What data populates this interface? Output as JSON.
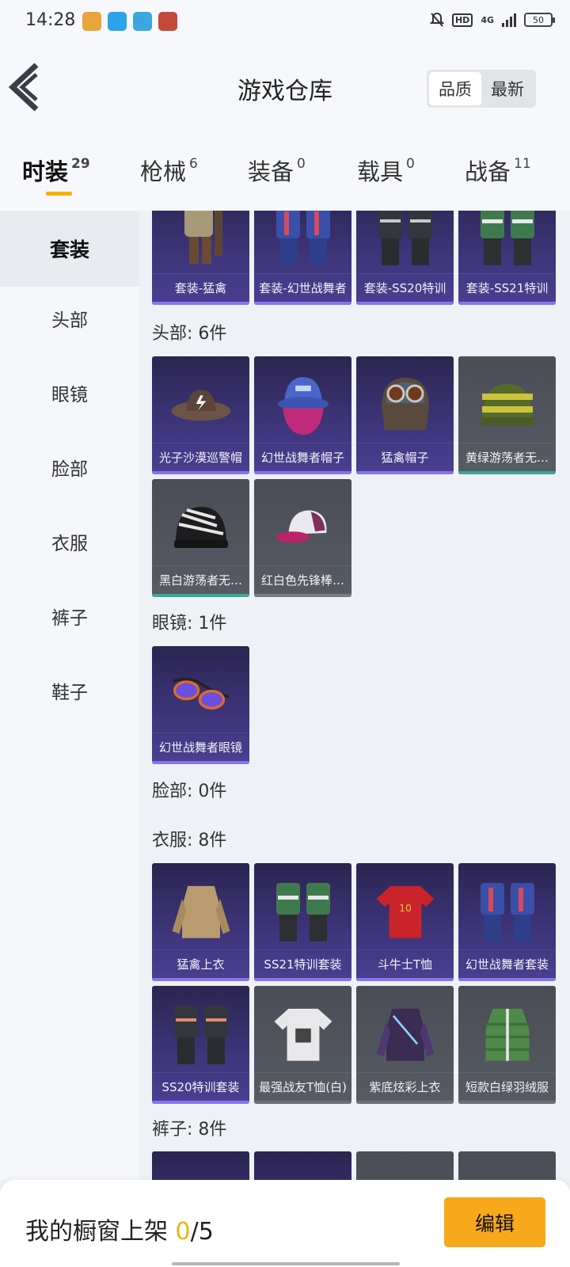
{
  "status_bar": {
    "time": "14:28",
    "apps": [
      {
        "icon": "game-app-icon",
        "color": "#e8a53a"
      },
      {
        "icon": "qq-penguin-icon",
        "color": "#2aa4e6"
      },
      {
        "icon": "app-100-icon",
        "color": "#3aa7e0"
      },
      {
        "icon": "demon-app-icon",
        "color": "#c24a3a"
      }
    ],
    "hd_label": "HD",
    "network_label": "4G",
    "battery": "50"
  },
  "header": {
    "title": "游戏仓库",
    "sort_options": [
      "品质",
      "最新"
    ],
    "active_sort": "品质"
  },
  "tabs": [
    {
      "label": "时装",
      "count": "29",
      "active": true
    },
    {
      "label": "枪械",
      "count": "6"
    },
    {
      "label": "装备",
      "count": "0"
    },
    {
      "label": "载具",
      "count": "0"
    },
    {
      "label": "战备",
      "count": "11"
    }
  ],
  "sidebar": {
    "items": [
      "套装",
      "头部",
      "眼镜",
      "脸部",
      "衣服",
      "裤子",
      "鞋子"
    ],
    "active": "套装"
  },
  "sections": {
    "suits": {
      "items": [
        {
          "label": "套装-猛禽",
          "art": "suit-raptor-icon"
        },
        {
          "label": "套装-幻世战舞者",
          "art": "suit-dancer-icon"
        },
        {
          "label": "套装-SS20特训",
          "art": "suit-ss20-icon"
        },
        {
          "label": "套装-SS21特训",
          "art": "suit-ss21-icon"
        }
      ]
    },
    "head": {
      "title": "头部: 6件",
      "items": [
        {
          "label": "光子沙漠巡警帽",
          "art": "cowboy-hat-icon"
        },
        {
          "label": "幻世战舞者帽子",
          "art": "bucket-hat-icon"
        },
        {
          "label": "猛禽帽子",
          "art": "pilot-helmet-icon"
        },
        {
          "label": "黄绿游荡者无…",
          "art": "striped-beanie-icon"
        },
        {
          "label": "黑白游荡者无…",
          "art": "zebra-beanie-icon"
        },
        {
          "label": "红白色先锋棒…",
          "art": "baseball-cap-icon"
        }
      ]
    },
    "glasses": {
      "title": "眼镜: 1件",
      "items": [
        {
          "label": "幻世战舞者眼镜",
          "art": "sunglasses-icon"
        }
      ]
    },
    "face": {
      "title": "脸部: 0件"
    },
    "clothes": {
      "title": "衣服: 8件",
      "items": [
        {
          "label": "猛禽上衣",
          "art": "jacket-icon"
        },
        {
          "label": "SS21特训套装",
          "art": "green-suit-icon"
        },
        {
          "label": "斗牛士T恤",
          "art": "red-jersey-icon"
        },
        {
          "label": "幻世战舞者套装",
          "art": "dancer-outfit-icon"
        },
        {
          "label": "SS20特训套装",
          "art": "black-suit-icon"
        },
        {
          "label": "最强战友T恤(白)",
          "art": "white-tshirt-icon"
        },
        {
          "label": "紫底炫彩上衣",
          "art": "purple-jacket-icon"
        },
        {
          "label": "短款白绿羽绒服",
          "art": "puffer-jacket-icon"
        }
      ]
    },
    "pants": {
      "title": "裤子: 8件"
    }
  },
  "bottom": {
    "label": "我的橱窗上架",
    "count": "0",
    "total": "/5",
    "edit_button": "编辑"
  }
}
